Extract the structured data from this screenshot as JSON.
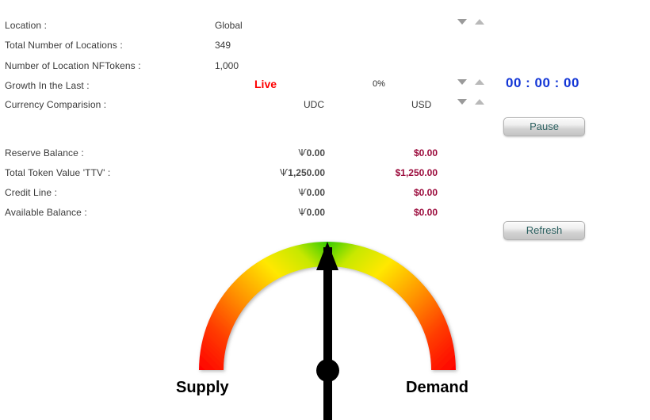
{
  "info_rows": [
    {
      "label": "Location :",
      "value": "Global",
      "has_spinner": true
    },
    {
      "label": "Total Number of Locations :",
      "value": "349",
      "has_spinner": false
    },
    {
      "label": "Number of Location NFTokens :",
      "value": "1,000",
      "has_spinner": false
    }
  ],
  "growth": {
    "label": "Growth In the Last :",
    "status": "Live",
    "percent": "0%",
    "timer": "00 : 00 : 00"
  },
  "currency": {
    "label": "Currency Comparision :",
    "base": "UDC",
    "quote": "USD"
  },
  "buttons": {
    "pause": "Pause",
    "refresh": "Refresh"
  },
  "balances": {
    "currency_symbol": "Ѱ",
    "rows": [
      {
        "label": "Reserve Balance :",
        "udc": "0.00",
        "usd": "$0.00"
      },
      {
        "label": "Total Token Value 'TTV' :",
        "udc": "1,250.00",
        "usd": "$1,250.00"
      },
      {
        "label": "Credit Line :",
        "udc": "0.00",
        "usd": "$0.00"
      },
      {
        "label": "Available Balance :",
        "udc": "0.00",
        "usd": "$0.00"
      }
    ]
  },
  "gauge": {
    "left_label": "Supply",
    "right_label": "Demand",
    "needle_angle_deg": 0,
    "colors": {
      "low": "#ff0000",
      "mid": "#ffee00",
      "high": "#33cc00"
    }
  },
  "chart_data": {
    "type": "gauge",
    "title": "",
    "min_label": "Supply",
    "max_label": "Demand",
    "value": 50,
    "range": [
      0,
      100
    ],
    "needle_position_pct": 50,
    "color_stops": [
      {
        "pct": 0,
        "color": "#ff0000"
      },
      {
        "pct": 18,
        "color": "#ff4400"
      },
      {
        "pct": 32,
        "color": "#ff9900"
      },
      {
        "pct": 42,
        "color": "#ffee00"
      },
      {
        "pct": 50,
        "color": "#33cc00"
      },
      {
        "pct": 58,
        "color": "#ffee00"
      },
      {
        "pct": 68,
        "color": "#ff9900"
      },
      {
        "pct": 82,
        "color": "#ff4400"
      },
      {
        "pct": 100,
        "color": "#ff0000"
      }
    ]
  }
}
